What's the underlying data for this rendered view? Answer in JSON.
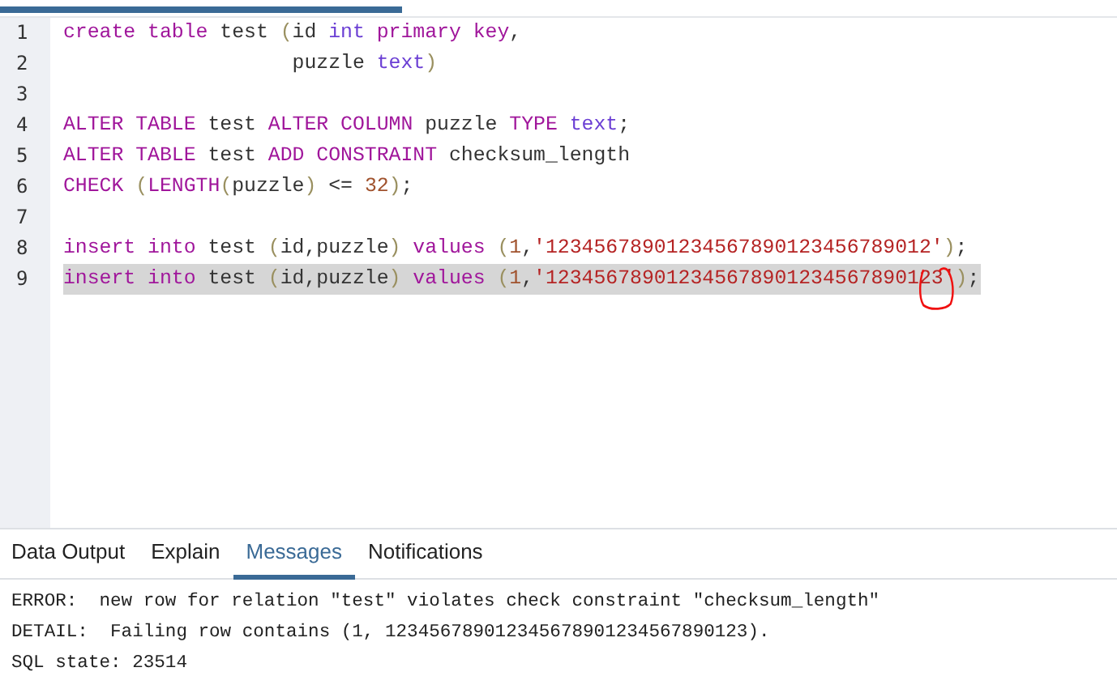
{
  "editor": {
    "lines": [
      {
        "number": "1",
        "highlighted": false,
        "tokens": [
          {
            "kind": "keyword",
            "text": "create table"
          },
          {
            "kind": "plain",
            "text": " test "
          },
          {
            "kind": "punct",
            "text": "("
          },
          {
            "kind": "plain",
            "text": "id "
          },
          {
            "kind": "type",
            "text": "int"
          },
          {
            "kind": "keyword",
            "text": " primary key"
          },
          {
            "kind": "plain",
            "text": ","
          }
        ]
      },
      {
        "number": "2",
        "highlighted": false,
        "tokens": [
          {
            "kind": "plain",
            "text": "                   puzzle "
          },
          {
            "kind": "type",
            "text": "text"
          },
          {
            "kind": "punct",
            "text": ")"
          }
        ]
      },
      {
        "number": "3"
      },
      {
        "number": "4",
        "highlighted": false,
        "tokens": [
          {
            "kind": "keyword",
            "text": "ALTER TABLE"
          },
          {
            "kind": "plain",
            "text": " test "
          },
          {
            "kind": "keyword",
            "text": "ALTER COLUMN"
          },
          {
            "kind": "plain",
            "text": " puzzle "
          },
          {
            "kind": "keyword",
            "text": "TYPE"
          },
          {
            "kind": "type",
            "text": " text"
          },
          {
            "kind": "plain",
            "text": ";"
          }
        ]
      },
      {
        "number": "5",
        "highlighted": false,
        "tokens": [
          {
            "kind": "keyword",
            "text": "ALTER TABLE"
          },
          {
            "kind": "plain",
            "text": " test "
          },
          {
            "kind": "keyword",
            "text": "ADD CONSTRAINT"
          },
          {
            "kind": "plain",
            "text": " checksum_length"
          }
        ]
      },
      {
        "number": "6",
        "highlighted": false,
        "tokens": [
          {
            "kind": "keyword",
            "text": "CHECK"
          },
          {
            "kind": "punct",
            "text": " ("
          },
          {
            "kind": "keyword",
            "text": "LENGTH"
          },
          {
            "kind": "punct",
            "text": "("
          },
          {
            "kind": "plain",
            "text": "puzzle"
          },
          {
            "kind": "punct",
            "text": ")"
          },
          {
            "kind": "plain",
            "text": " <= "
          },
          {
            "kind": "number",
            "text": "32"
          },
          {
            "kind": "punct",
            "text": ")"
          },
          {
            "kind": "plain",
            "text": ";"
          }
        ]
      },
      {
        "number": "7"
      },
      {
        "number": "8",
        "highlighted": false,
        "tokens": [
          {
            "kind": "keyword",
            "text": "insert into"
          },
          {
            "kind": "plain",
            "text": " test "
          },
          {
            "kind": "punct",
            "text": "("
          },
          {
            "kind": "plain",
            "text": "id,puzzle"
          },
          {
            "kind": "punct",
            "text": ")"
          },
          {
            "kind": "keyword",
            "text": " values"
          },
          {
            "kind": "punct",
            "text": " ("
          },
          {
            "kind": "number",
            "text": "1"
          },
          {
            "kind": "plain",
            "text": ","
          },
          {
            "kind": "string",
            "text": "'12345678901234567890123456789012'"
          },
          {
            "kind": "punct",
            "text": ")"
          },
          {
            "kind": "plain",
            "text": ";"
          }
        ]
      },
      {
        "number": "9",
        "highlighted": true,
        "tokens": [
          {
            "kind": "keyword",
            "text": "insert into"
          },
          {
            "kind": "plain",
            "text": " test "
          },
          {
            "kind": "punct",
            "text": "("
          },
          {
            "kind": "plain",
            "text": "id,puzzle"
          },
          {
            "kind": "punct",
            "text": ")"
          },
          {
            "kind": "keyword",
            "text": " values"
          },
          {
            "kind": "punct",
            "text": " ("
          },
          {
            "kind": "number",
            "text": "1"
          },
          {
            "kind": "plain",
            "text": ","
          },
          {
            "kind": "string",
            "text": "'123456789012345678901234567890123'"
          },
          {
            "kind": "punct",
            "text": ")"
          },
          {
            "kind": "plain",
            "text": ";"
          }
        ]
      }
    ]
  },
  "output_tabs": [
    {
      "label": "Data Output",
      "selected": false
    },
    {
      "label": "Explain",
      "selected": false
    },
    {
      "label": "Messages",
      "selected": true
    },
    {
      "label": "Notifications",
      "selected": false
    }
  ],
  "messages": [
    "ERROR:  new row for relation \"test\" violates check constraint \"checksum_length\"",
    "DETAIL:  Failing row contains (1, 123456789012345678901234567890123).",
    "SQL state: 23514"
  ]
}
